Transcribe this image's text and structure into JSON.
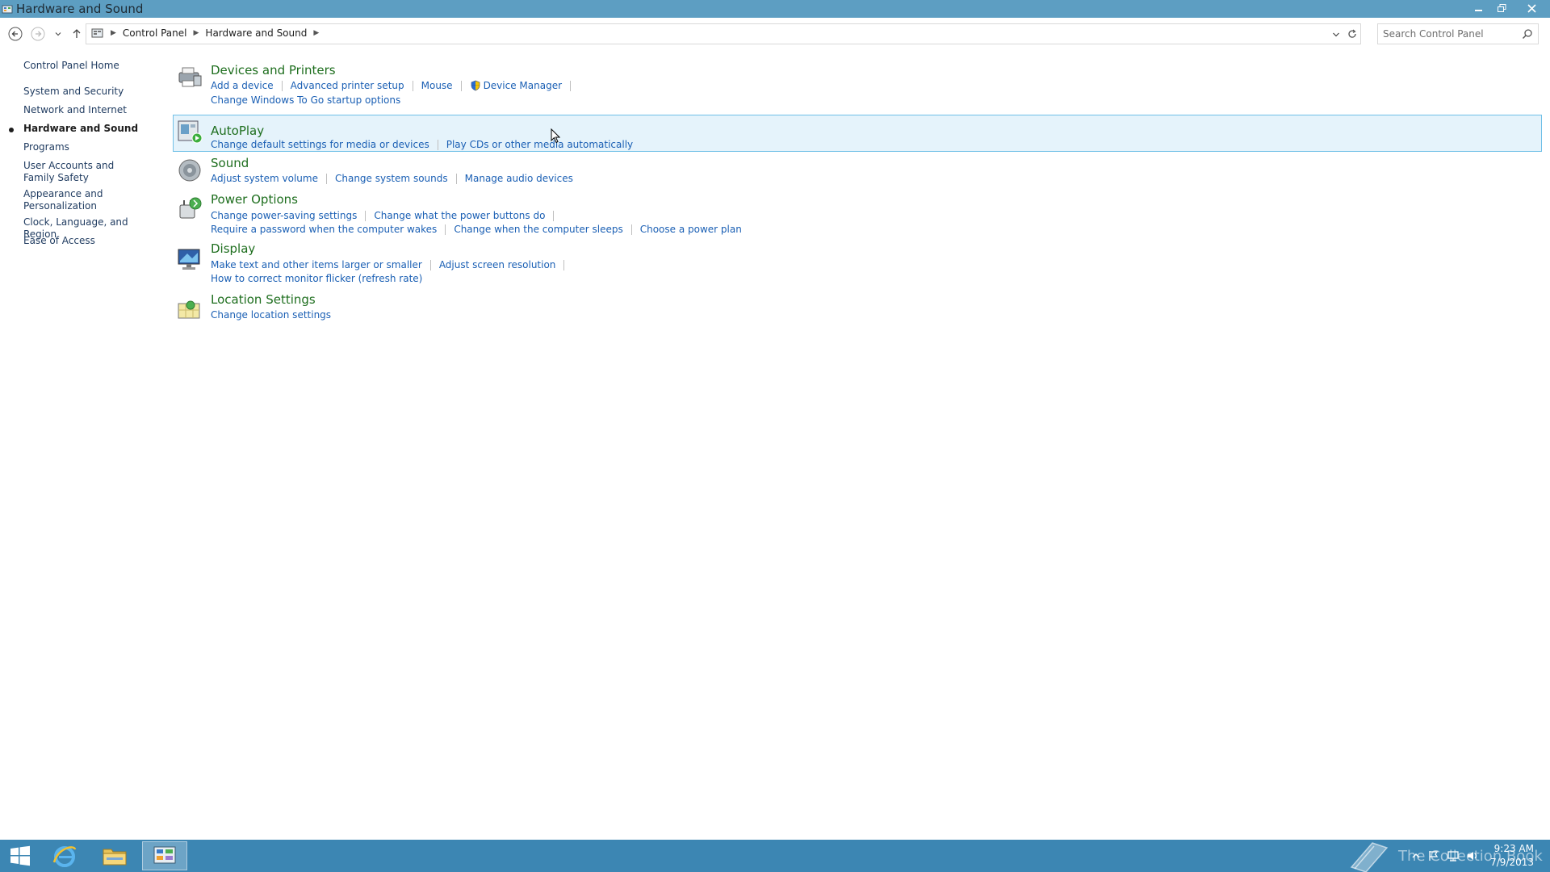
{
  "window": {
    "title": "Hardware and Sound",
    "controls": {
      "minimize": "minimize",
      "restore": "restore",
      "close": "close"
    }
  },
  "address": {
    "breadcrumbs": [
      "Control Panel",
      "Hardware and Sound"
    ]
  },
  "search": {
    "placeholder": "Search Control Panel"
  },
  "left_pane": {
    "home": "Control Panel Home",
    "items": [
      {
        "label": "System and Security",
        "active": false
      },
      {
        "label": "Network and Internet",
        "active": false
      },
      {
        "label": "Hardware and Sound",
        "active": true
      },
      {
        "label": "Programs",
        "active": false
      },
      {
        "label": "User Accounts and Family Safety",
        "active": false
      },
      {
        "label": "Appearance and Personalization",
        "active": false
      },
      {
        "label": "Clock, Language, and Region",
        "active": false
      },
      {
        "label": "Ease of Access",
        "active": false
      }
    ]
  },
  "categories": [
    {
      "title": "Devices and Printers",
      "icon": "printer-icon",
      "links": [
        [
          "Add a device",
          "Advanced printer setup",
          "Mouse",
          "Device Manager"
        ],
        [
          "Change Windows To Go startup options"
        ]
      ]
    },
    {
      "title": "AutoPlay",
      "icon": "autoplay-icon",
      "links": [
        [
          "Change default settings for media or devices",
          "Play CDs or other media automatically"
        ]
      ]
    },
    {
      "title": "Sound",
      "icon": "speaker-icon",
      "links": [
        [
          "Adjust system volume",
          "Change system sounds",
          "Manage audio devices"
        ]
      ]
    },
    {
      "title": "Power Options",
      "icon": "power-icon",
      "links": [
        [
          "Change power-saving settings",
          "Change what the power buttons do"
        ],
        [
          "Require a password when the computer wakes",
          "Change when the computer sleeps",
          "Choose a power plan"
        ]
      ]
    },
    {
      "title": "Display",
      "icon": "monitor-icon",
      "links": [
        [
          "Make text and other items larger or smaller",
          "Adjust screen resolution"
        ],
        [
          "How to correct monitor flicker (refresh rate)"
        ]
      ]
    },
    {
      "title": "Location Settings",
      "icon": "location-icon",
      "links": [
        [
          "Change location settings"
        ]
      ]
    }
  ],
  "taskbar": {
    "watermark": "The Collection Book",
    "time": "9:23 AM",
    "date": "7/9/2013"
  },
  "colors": {
    "titlebar": "#5d9ec2",
    "taskbar": "#3c86b3",
    "link": "#1a5fb4",
    "category_title": "#1e6e1e",
    "hover_bg": "#e5f3fb",
    "hover_border": "#70c0e7"
  }
}
